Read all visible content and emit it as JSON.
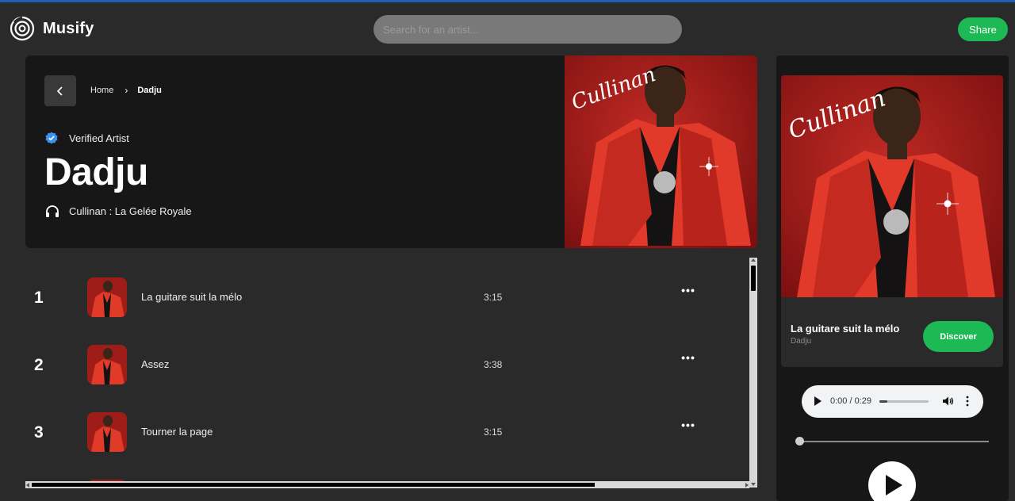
{
  "app": {
    "name": "Musify",
    "accent_color": "#1db954"
  },
  "header": {
    "search_placeholder": "Search for an artist...",
    "share_label": "Share"
  },
  "breadcrumb": {
    "home": "Home",
    "separator": "›",
    "current": "Dadju"
  },
  "artist": {
    "verified_label": "Verified Artist",
    "name": "Dadju",
    "album_line": "Cullinan : La Gelée Royale",
    "cover_logo_text": "Cullinan"
  },
  "tracks": [
    {
      "number": "1",
      "title": "La guitare suit la mélo",
      "duration": "3:15",
      "more": "•••"
    },
    {
      "number": "2",
      "title": "Assez",
      "duration": "3:38",
      "more": "•••"
    },
    {
      "number": "3",
      "title": "Tourner la page",
      "duration": "3:15",
      "more": "•••"
    }
  ],
  "now_playing": {
    "title": "La guitare suit la mélo",
    "artist": "Dadju",
    "discover_label": "Discover",
    "time": "0:00 / 0:29",
    "audio_progress": 0.0,
    "track_progress": 0.0
  }
}
